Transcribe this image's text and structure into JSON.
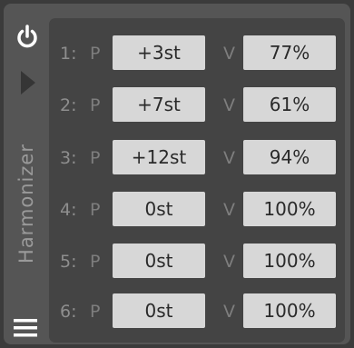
{
  "device": {
    "name": "Harmonizer"
  },
  "rows": [
    {
      "num": "1:",
      "p_label": "P",
      "pitch": "+3st",
      "v_label": "V",
      "volume": "77%"
    },
    {
      "num": "2:",
      "p_label": "P",
      "pitch": "+7st",
      "v_label": "V",
      "volume": "61%"
    },
    {
      "num": "3:",
      "p_label": "P",
      "pitch": "+12st",
      "v_label": "V",
      "volume": "94%"
    },
    {
      "num": "4:",
      "p_label": "P",
      "pitch": "0st",
      "v_label": "V",
      "volume": "100%"
    },
    {
      "num": "5:",
      "p_label": "P",
      "pitch": "0st",
      "v_label": "V",
      "volume": "100%"
    },
    {
      "num": "6:",
      "p_label": "P",
      "pitch": "0st",
      "v_label": "V",
      "volume": "100%"
    }
  ],
  "icons": {
    "power": "power-icon",
    "expand": "play-triangle-icon",
    "menu": "hamburger-menu-icon"
  },
  "colors": {
    "frame": "#555555",
    "panel": "#444444",
    "value_box": "#d7d7d7",
    "value_text": "#2a2a2a",
    "label": "#7e7e7e"
  }
}
